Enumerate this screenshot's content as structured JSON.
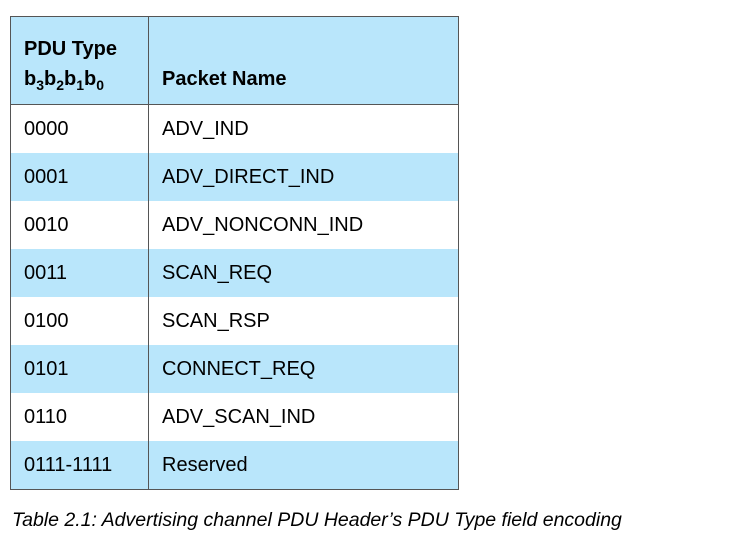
{
  "table": {
    "header": {
      "col1_line1": "PDU Type",
      "col1_bits": [
        "b",
        "3",
        "b",
        "2",
        "b",
        "1",
        "b",
        "0"
      ],
      "col2": "Packet Name"
    },
    "rows": [
      {
        "type": "0000",
        "name": "ADV_IND"
      },
      {
        "type": "0001",
        "name": "ADV_DIRECT_IND"
      },
      {
        "type": "0010",
        "name": "ADV_NONCONN_IND"
      },
      {
        "type": "0011",
        "name": "SCAN_REQ"
      },
      {
        "type": "0100",
        "name": "SCAN_RSP"
      },
      {
        "type": "0101",
        "name": "CONNECT_REQ"
      },
      {
        "type": "0110",
        "name": "ADV_SCAN_IND"
      },
      {
        "type": "0111-1111",
        "name": "Reserved"
      }
    ]
  },
  "caption": "Table 2.1: Advertising channel PDU Header’s PDU Type field encoding",
  "colors": {
    "header_bg": "#b9e6fb",
    "alt_row_bg": "#b9e6fb"
  }
}
